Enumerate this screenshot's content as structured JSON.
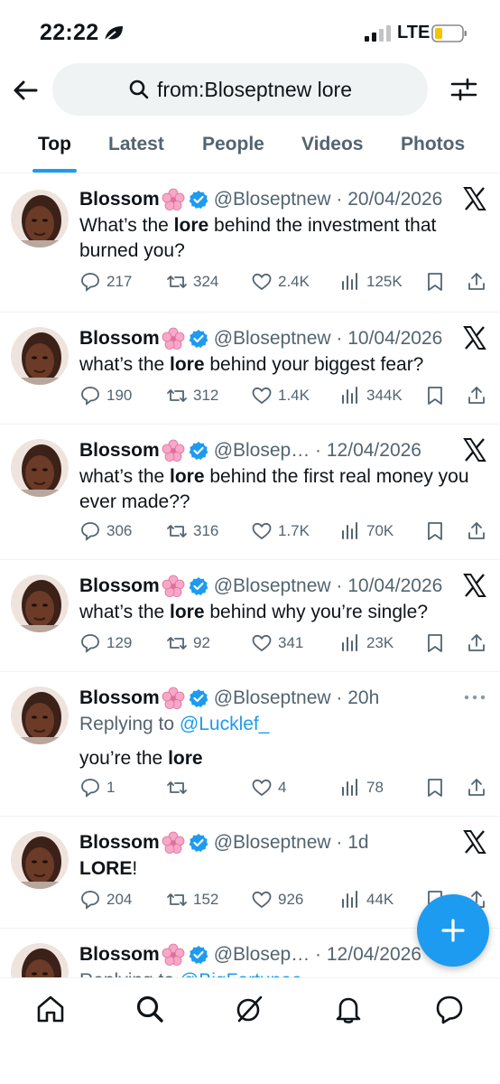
{
  "status_bar": {
    "time": "22:22",
    "network": "LTE"
  },
  "search": {
    "query": "from:Bloseptnew lore"
  },
  "tabs": [
    {
      "label": "Top",
      "active": true
    },
    {
      "label": "Latest",
      "active": false
    },
    {
      "label": "People",
      "active": false
    },
    {
      "label": "Videos",
      "active": false
    },
    {
      "label": "Photos",
      "active": false
    }
  ],
  "tweets": [
    {
      "name": "Blossom",
      "handle_date": "@Bloseptnew · 20/04/2026",
      "text_before": "What’s the ",
      "text_bold": "lore",
      "text_after": " behind the investment that burned you?",
      "replies": "217",
      "reposts": "324",
      "likes": "2.4K",
      "views": "125K"
    },
    {
      "name": "Blossom",
      "handle_date": "@Bloseptnew · 10/04/2026",
      "text_before": "what’s the ",
      "text_bold": "lore",
      "text_after": " behind your biggest fear?",
      "replies": "190",
      "reposts": "312",
      "likes": "1.4K",
      "views": "344K"
    },
    {
      "name": "Blossom",
      "handle_date": "@Blosep… · 12/04/2026",
      "text_before": "what’s the ",
      "text_bold": "lore",
      "text_after": " behind the first real money you ever made??",
      "replies": "306",
      "reposts": "316",
      "likes": "1.7K",
      "views": "70K"
    },
    {
      "name": "Blossom",
      "handle_date": "@Bloseptnew · 10/04/2026",
      "text_before": "what’s the ",
      "text_bold": "lore",
      "text_after": " behind why you’re single?",
      "replies": "129",
      "reposts": "92",
      "likes": "341",
      "views": "23K"
    },
    {
      "name": "Blossom",
      "handle_date": "@Bloseptnew · 20h",
      "reply_prefix": "Replying to ",
      "reply_handle": "@Lucklef_",
      "text_before": "you’re the ",
      "text_bold": "lore",
      "text_after": "",
      "replies": "1",
      "reposts": "",
      "likes": "4",
      "views": "78"
    },
    {
      "name": "Blossom",
      "handle_date": "@Bloseptnew · 1d",
      "text_before": "",
      "text_bold": "LORE",
      "text_after": "!",
      "replies": "204",
      "reposts": "152",
      "likes": "926",
      "views": "44K"
    },
    {
      "name": "Blossom",
      "handle_date": "@Blosep… · 12/04/2026",
      "reply_prefix": "Replying to ",
      "reply_handle": "@BigFortunee"
    }
  ],
  "icons": {
    "accent": "#1d9bf0",
    "muted": "#536471",
    "blossom_pink": "#f7a8c8"
  }
}
